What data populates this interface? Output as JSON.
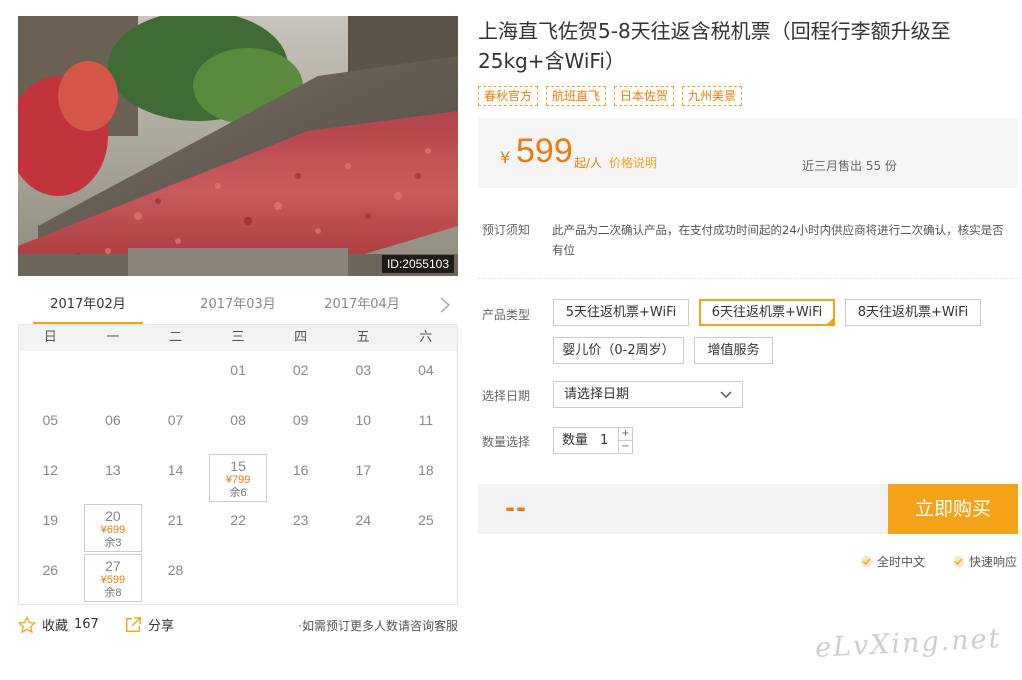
{
  "product": {
    "title": "上海直飞佐贺5-8天往返含税机票（回程行李额升级至25kg+含WiFi）",
    "tags": [
      "春秋官方",
      "航班直飞",
      "日本佐贺",
      "九州美景"
    ],
    "image_id": "ID:2055103"
  },
  "price": {
    "currency": "¥",
    "amount": "599",
    "unit": "起/人",
    "link": "价格说明",
    "sold": "近三月售出 55 份"
  },
  "notice": {
    "label": "预订须知",
    "text": "此产品为二次确认产品，在支付成功时间起的24小时内供应商将进行二次确认，核实是否有位"
  },
  "product_type": {
    "label": "产品类型",
    "options": [
      "5天往返机票+WiFi",
      "6天往返机票+WiFi",
      "8天往返机票+WiFi",
      "婴儿价（0-2周岁）",
      "增值服务"
    ],
    "selected_index": 1
  },
  "date": {
    "label": "选择日期",
    "placeholder": "请选择日期"
  },
  "quantity": {
    "label": "数量选择",
    "field_label": "数量",
    "value": "1",
    "plus": "+",
    "minus": "−"
  },
  "buy": {
    "total": "--",
    "button": "立即购买"
  },
  "guarantees": [
    "全时中文",
    "快速响应"
  ],
  "calendar": {
    "months": [
      "2017年02月",
      "2017年03月",
      "2017年04月"
    ],
    "active_month_index": 0,
    "weekdays": [
      "日",
      "一",
      "二",
      "三",
      "四",
      "五",
      "六"
    ],
    "days": [
      {
        "d": "01"
      },
      {
        "d": "02"
      },
      {
        "d": "03"
      },
      {
        "d": "04"
      },
      {
        "d": "05"
      },
      {
        "d": "06"
      },
      {
        "d": "07"
      },
      {
        "d": "08"
      },
      {
        "d": "09"
      },
      {
        "d": "10"
      },
      {
        "d": "11"
      },
      {
        "d": "12"
      },
      {
        "d": "13"
      },
      {
        "d": "14"
      },
      {
        "d": "15",
        "price": "¥799",
        "left": "余6"
      },
      {
        "d": "16"
      },
      {
        "d": "17"
      },
      {
        "d": "18"
      },
      {
        "d": "19"
      },
      {
        "d": "20",
        "price": "¥699",
        "left": "余3"
      },
      {
        "d": "21"
      },
      {
        "d": "22"
      },
      {
        "d": "23"
      },
      {
        "d": "24"
      },
      {
        "d": "25"
      },
      {
        "d": "26"
      },
      {
        "d": "27",
        "price": "¥599",
        "left": "余8"
      },
      {
        "d": "28"
      }
    ]
  },
  "actions": {
    "favorite": "收藏",
    "favorite_count": "167",
    "share": "分享",
    "consult": "·如需预订更多人数请咨询客服"
  },
  "watermark": "eLvXing.net",
  "colors": {
    "accent": "#f5a31b",
    "price": "#f07b0a",
    "panel": "#f5f5f5"
  }
}
